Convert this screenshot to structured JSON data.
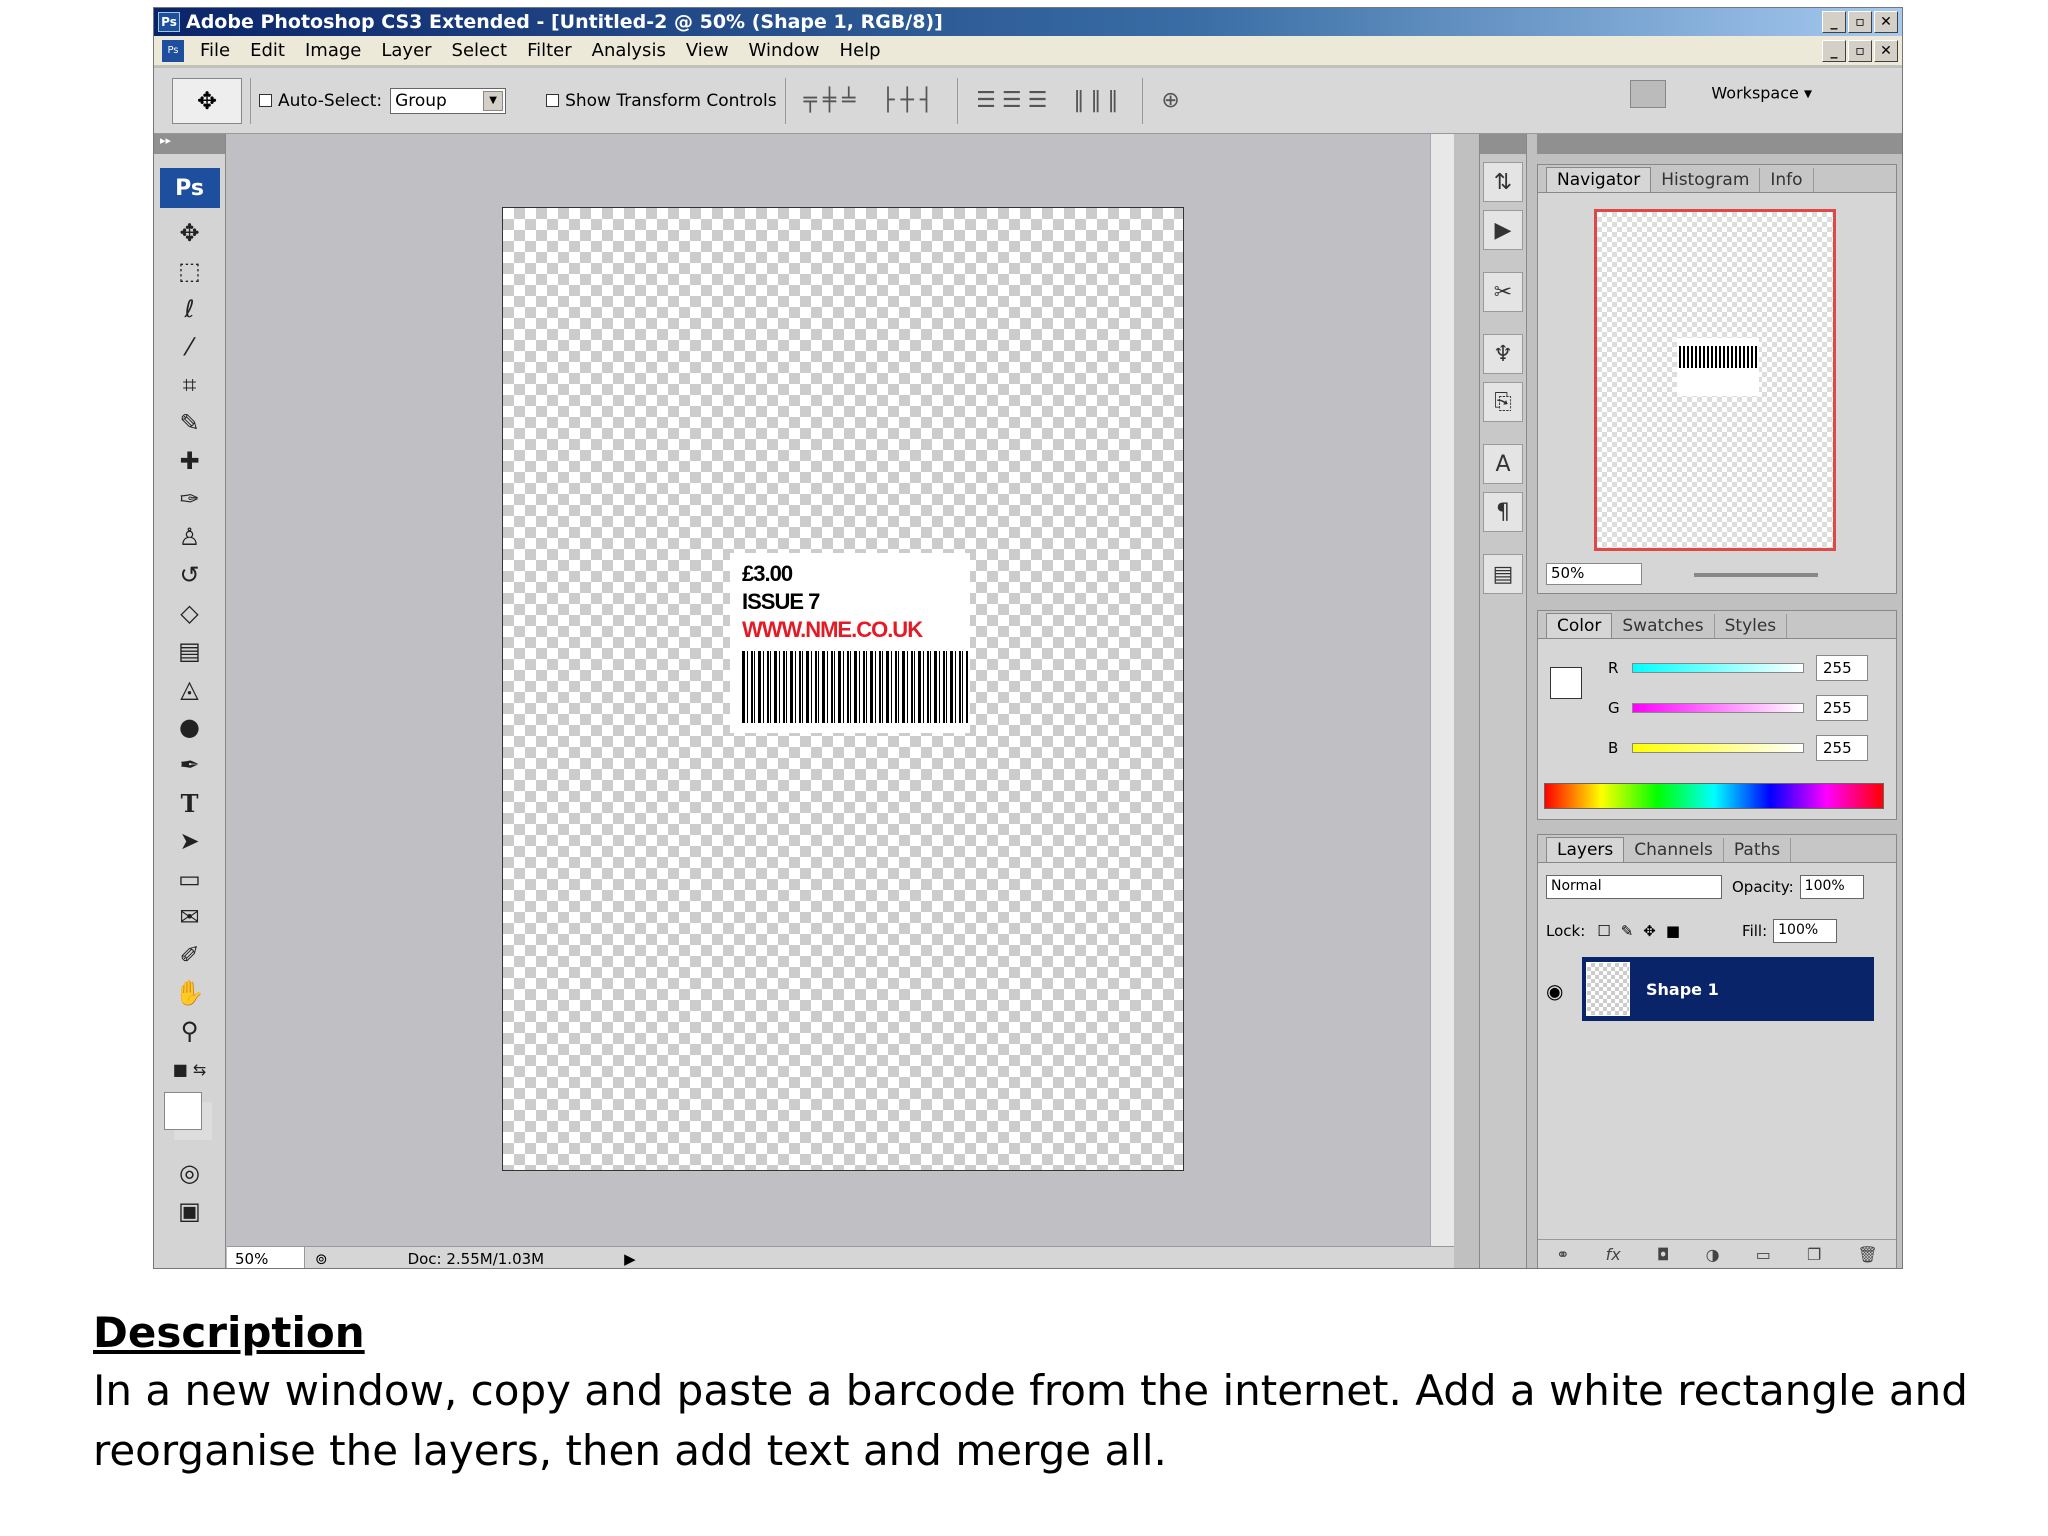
{
  "window": {
    "title": "Adobe Photoshop CS3 Extended - [Untitled-2 @ 50% (Shape 1, RGB/8)]",
    "app_icon": "Ps",
    "controls": [
      "_",
      "▫",
      "✕"
    ]
  },
  "menu": [
    "File",
    "Edit",
    "Image",
    "Layer",
    "Select",
    "Filter",
    "Analysis",
    "View",
    "Window",
    "Help"
  ],
  "options": {
    "auto_select_label": "Auto-Select:",
    "auto_select_value": "Group",
    "show_transform_label": "Show Transform Controls",
    "workspace_label": "Workspace ▾"
  },
  "toolbox": {
    "badge": "Ps",
    "tools": [
      "move-tool",
      "marquee-tool",
      "lasso-tool",
      "magic-wand-tool",
      "crop-tool",
      "eyedropper-tool",
      "healing-brush-tool",
      "brush-tool",
      "clone-stamp-tool",
      "history-brush-tool",
      "eraser-tool",
      "gradient-tool",
      "blur-tool",
      "dodge-tool",
      "pen-tool",
      "type-tool",
      "path-selection-tool",
      "shape-tool",
      "notes-tool",
      "eyedropper-tool-2",
      "hand-tool",
      "zoom-tool"
    ]
  },
  "document": {
    "label_price": "£3.00",
    "label_issue": "ISSUE 7",
    "label_url": "WWW.NME.CO.UK"
  },
  "status": {
    "zoom": "50%",
    "doc": "Doc: 2.55M/1.03M"
  },
  "navigator": {
    "tabs": [
      "Navigator",
      "Histogram",
      "Info"
    ],
    "zoom": "50%"
  },
  "color_panel": {
    "tabs": [
      "Color",
      "Swatches",
      "Styles"
    ],
    "r_label": "R",
    "r_value": "255",
    "g_label": "G",
    "g_value": "255",
    "b_label": "B",
    "b_value": "255"
  },
  "layers_panel": {
    "tabs": [
      "Layers",
      "Channels",
      "Paths"
    ],
    "blend_mode": "Normal",
    "opacity_label": "Opacity:",
    "opacity_value": "100%",
    "lock_label": "Lock:",
    "fill_label": "Fill:",
    "fill_value": "100%",
    "layer_name": "Shape 1"
  },
  "description": {
    "heading": "Description",
    "text": "In a new window, copy and paste a barcode from the internet. Add a white rectangle and reorganise the layers, then add text and merge all."
  }
}
